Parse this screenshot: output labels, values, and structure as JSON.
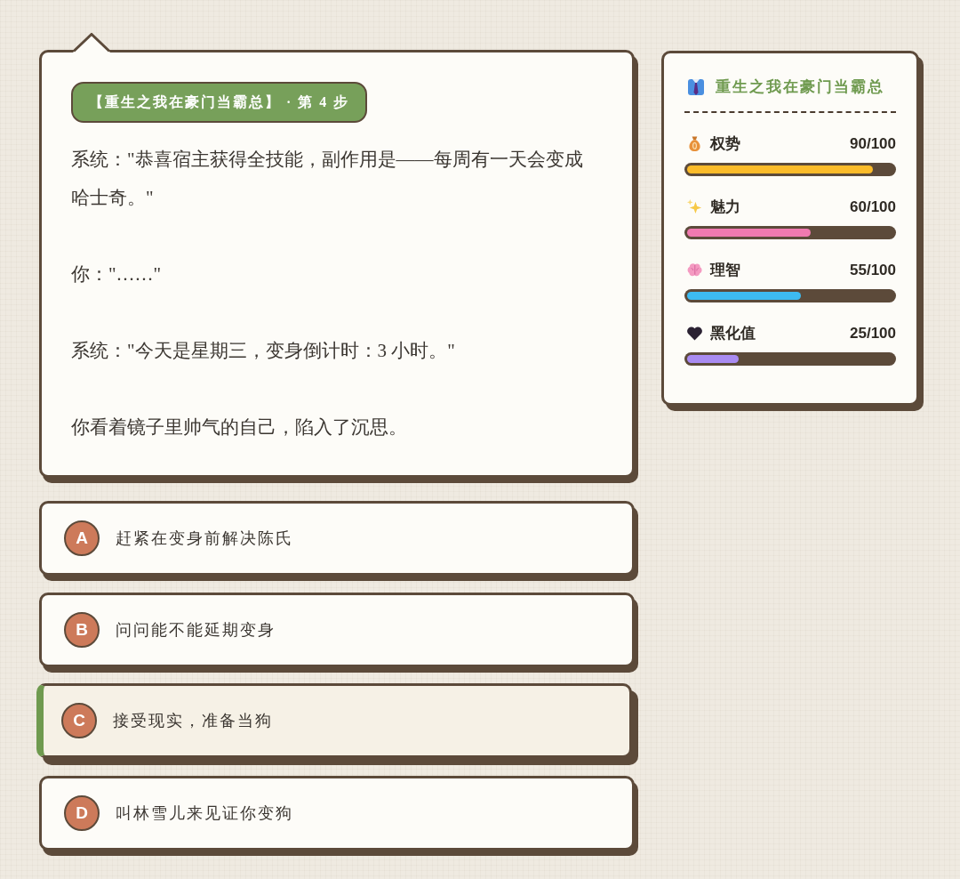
{
  "story": {
    "header": "【重生之我在豪门当霸总】 · 第 4 步",
    "paragraphs": [
      "系统：\"恭喜宿主获得全技能，副作用是——每周有一天会变成哈士奇。\"",
      "你：\"……\"",
      "系统：\"今天是星期三，变身倒计时：3 小时。\"",
      "你看着镜子里帅气的自己，陷入了沉思。"
    ]
  },
  "choices": [
    {
      "letter": "A",
      "text": "赶紧在变身前解决陈氏",
      "selected": false
    },
    {
      "letter": "B",
      "text": "问问能不能延期变身",
      "selected": false
    },
    {
      "letter": "C",
      "text": "接受现实，准备当狗",
      "selected": true
    },
    {
      "letter": "D",
      "text": "叫林雪儿来见证你变狗",
      "selected": false
    }
  ],
  "stats_panel": {
    "title": "重生之我在豪门当霸总",
    "stats": [
      {
        "label": "权势",
        "value": "90/100",
        "level": 0.9,
        "color": "#fbbb2a"
      },
      {
        "label": "魅力",
        "value": "60/100",
        "level": 0.6,
        "color": "#f07ab0"
      },
      {
        "label": "理智",
        "value": "55/100",
        "level": 0.55,
        "color": "#3dbbf1"
      },
      {
        "label": "黑化值",
        "value": "25/100",
        "level": 0.25,
        "color": "#a98bf2"
      }
    ]
  }
}
